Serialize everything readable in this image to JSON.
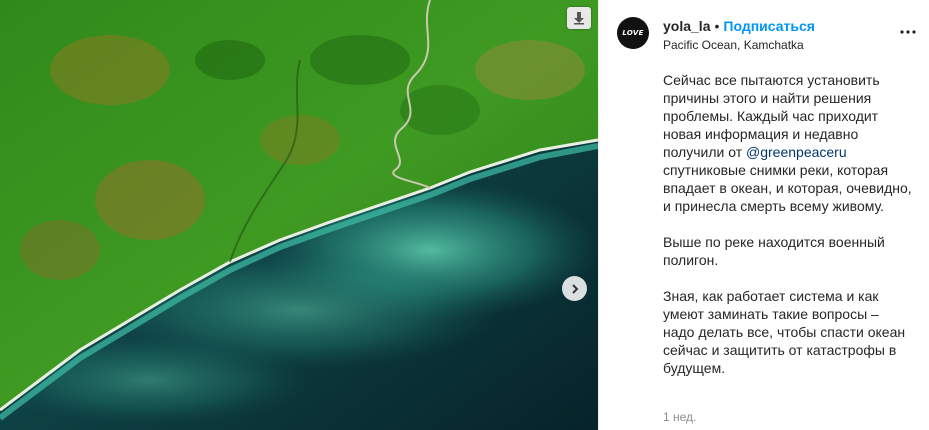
{
  "post": {
    "username": "yola_la",
    "separator": "•",
    "follow_label": "Подписаться",
    "location": "Pacific Ocean, Kamchatka",
    "avatar_text": "LOVE",
    "caption": {
      "p1_before": "Сейчас все пытаются установить причины этого и найти решения проблемы. Каждый час приходит новая информация и недавно получили от ",
      "mention": "@greenpeaceru",
      "p1_after": " спутниковые снимки реки, которая впадает в океан, и которая, очевидно, и принесла смерть всему живому.",
      "p2": "Выше по реке находится военный полигон.",
      "p3": "Зная, как работает система и как умеют заминать такие вопросы – надо делать все, чтобы спасти океан сейчас и защитить от катастрофы в будущем."
    },
    "timestamp": "1 нед."
  },
  "media": {
    "image_subject": "satellite-coastline",
    "icons": {
      "save": "download-arrow-icon",
      "next": "chevron-right-icon",
      "more": "more-dots-icon"
    }
  },
  "colors": {
    "accent": "#0095f6",
    "mention": "#00376b",
    "muted": "#8e8e8e",
    "land": "#3a8f1e",
    "ocean": "#0d3a3e",
    "surf": "#3fbfa6"
  }
}
